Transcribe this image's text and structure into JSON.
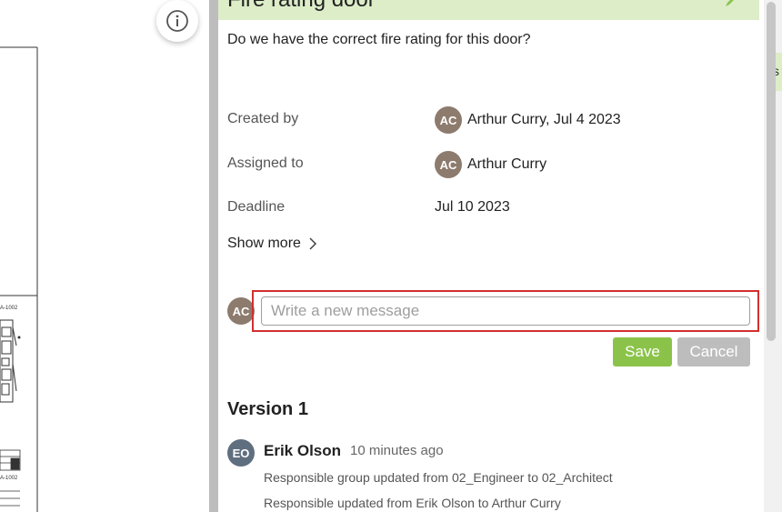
{
  "panel": {
    "title": "Fire rating door",
    "question": "Do we have the correct fire rating for this door?"
  },
  "meta": {
    "created_by_label": "Created by",
    "created_by_initials": "AC",
    "created_by_value": "Arthur Curry, Jul 4 2023",
    "assigned_to_label": "Assigned to",
    "assigned_to_initials": "AC",
    "assigned_to_value": "Arthur Curry",
    "deadline_label": "Deadline",
    "deadline_value": "Jul 10 2023"
  },
  "show_more": "Show more",
  "composer": {
    "avatar_initials": "AC",
    "placeholder": "Write a new message",
    "save_label": "Save",
    "cancel_label": "Cancel"
  },
  "version": {
    "title": "Version 1",
    "activity": {
      "initials": "EO",
      "author": "Erik Olson",
      "time": "10 minutes ago",
      "lines": [
        "Responsible group updated from 02_Engineer to 02_Architect",
        "Responsible updated from Erik Olson to Arthur Curry"
      ]
    }
  },
  "drawing": {
    "sheet_label_1": "A-1002",
    "sheet_label_2": "A-1002"
  },
  "edge_tab_text": "s",
  "colors": {
    "accent_green": "#8bc34a",
    "title_bg": "#dcedc8",
    "cancel_gray": "#bdbdbd",
    "highlight_red": "#d32f2f"
  }
}
